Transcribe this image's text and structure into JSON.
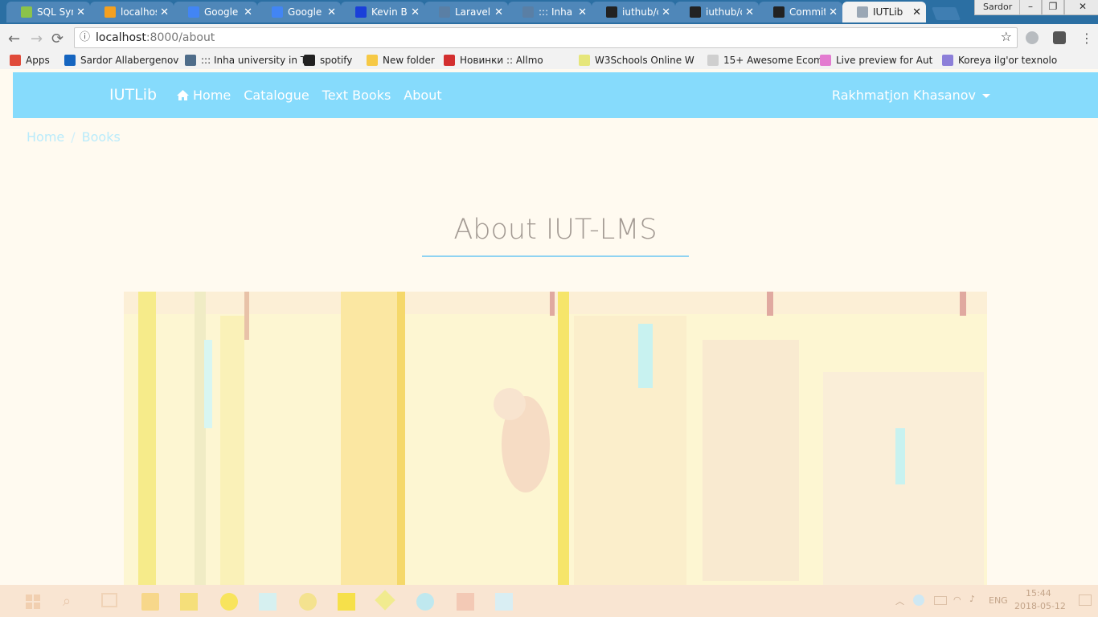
{
  "tabs": [
    {
      "title": "SQL Syn",
      "color": "#8bc34a"
    },
    {
      "title": "localhos",
      "color": "#f4a020"
    },
    {
      "title": "Google I",
      "color": "#4285f4"
    },
    {
      "title": "Google I",
      "color": "#4285f4"
    },
    {
      "title": "Kevin Ba",
      "color": "#1a3fd9"
    },
    {
      "title": "Laravel",
      "color": "#5a7fa5"
    },
    {
      "title": "::: Inha u",
      "color": "#5a7fa5"
    },
    {
      "title": "iuthub/c",
      "color": "#222222"
    },
    {
      "title": "iuthub/c",
      "color": "#222222"
    },
    {
      "title": "Commit",
      "color": "#222222"
    },
    {
      "title": "IUTLib",
      "color": "#9aa7b5",
      "active": true
    }
  ],
  "window": {
    "profile": "Sardor",
    "minimize": "–",
    "maximize": "❐",
    "close": "✕"
  },
  "address": {
    "host": "localhost",
    "path": ":8000/about"
  },
  "bookmarks": [
    {
      "label": "Apps",
      "color": "#e04b3a"
    },
    {
      "label": "Sardor Allabergenov",
      "color": "#1565c0"
    },
    {
      "label": "::: Inha university in T",
      "color": "#4f6d8a"
    },
    {
      "label": "spotify",
      "color": "#222222"
    },
    {
      "label": "New folder",
      "color": "#f6c945"
    },
    {
      "label": "Новинки :: Allmo",
      "color": "#d32f2f"
    },
    {
      "label": "W3Schools Online W",
      "color": "#e6e67a"
    },
    {
      "label": "15+ Awesome Ecom",
      "color": "#cfcfcf"
    },
    {
      "label": "Live preview for Aut",
      "color": "#e37bd0"
    },
    {
      "label": "Koreya ilg'or texnolo",
      "color": "#8c7fd9"
    }
  ],
  "site": {
    "brand": "IUTLib",
    "nav": [
      "Home",
      "Catalogue",
      "Text Books",
      "About"
    ],
    "user": "Rakhmatjon Khasanov",
    "breadcrumb": [
      "Home",
      "Books"
    ],
    "title": "About IUT-LMS"
  },
  "colors": {
    "navbar": "#86dbfc",
    "underline": "#8fd3f2"
  },
  "taskbar": {
    "lang": "ENG",
    "time": "15:44",
    "date": "2018-05-12"
  }
}
